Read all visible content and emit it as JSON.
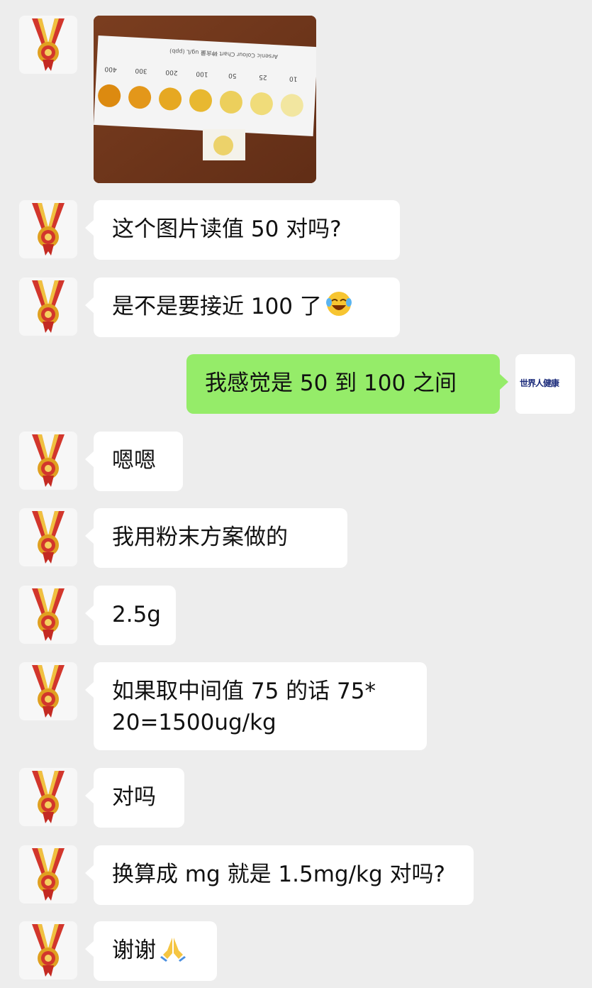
{
  "chat": {
    "photo": {
      "chart_title": "Arsenic Colour Chart 砷含量 ug/L (ppb)",
      "chart_values": [
        "10",
        "25",
        "50",
        "100",
        "200",
        "300",
        "400"
      ],
      "swatch_colors": [
        "#f2e6a0",
        "#f0dc7a",
        "#eccf5c",
        "#e8b830",
        "#e6a822",
        "#e3971a",
        "#dc8a10"
      ],
      "sample_color": "#ecd26a"
    },
    "messages": [
      {
        "from": "other",
        "text": "这个图片读值 50 对吗?"
      },
      {
        "from": "other",
        "text": "是不是要接近 100 了",
        "emoji": "laughing-tears"
      },
      {
        "from": "me",
        "text": "我感觉是 50 到 100 之间"
      },
      {
        "from": "other",
        "text": "嗯嗯"
      },
      {
        "from": "other",
        "text": "我用粉末方案做的"
      },
      {
        "from": "other",
        "text": "2.5g"
      },
      {
        "from": "other",
        "line1": "如果取中间值 75 的话 75*",
        "line2": "20=1500ug/kg"
      },
      {
        "from": "other",
        "text": "对吗"
      },
      {
        "from": "other",
        "text": "换算成 mg 就是 1.5mg/kg 对吗?"
      },
      {
        "from": "other",
        "text": "谢谢",
        "emoji": "pray"
      }
    ],
    "colors": {
      "background": "#ededed",
      "me_bubble": "#95ec69",
      "other_bubble": "#ffffff"
    },
    "my_avatar_label": "世界人健康"
  }
}
